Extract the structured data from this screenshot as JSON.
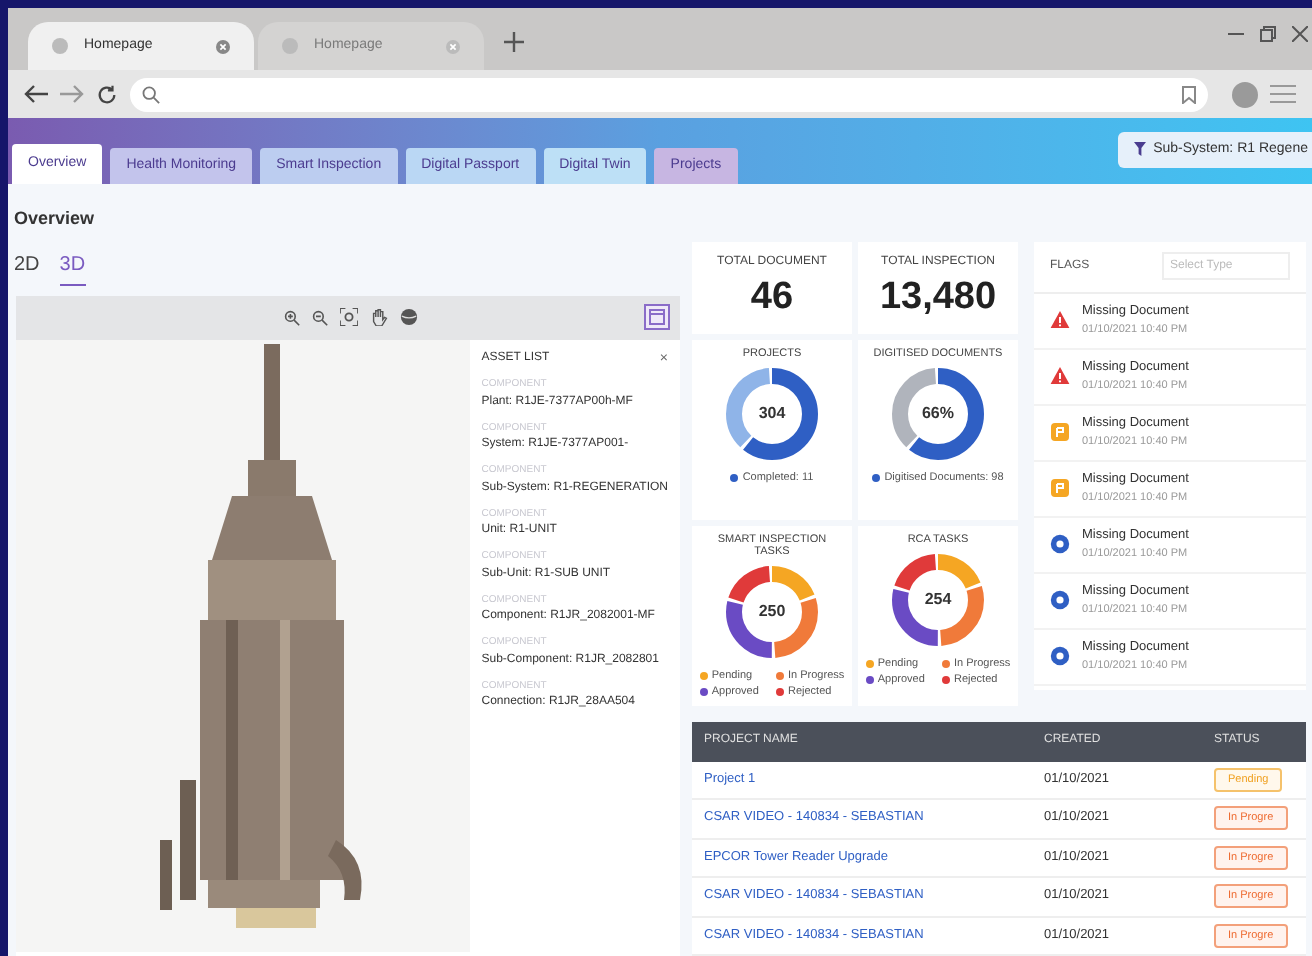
{
  "browser": {
    "tabs": [
      {
        "title": "Homepage",
        "selected": true
      },
      {
        "title": "Homepage",
        "selected": false
      }
    ]
  },
  "app_tabs": [
    {
      "label": "Overview",
      "selected": true
    },
    {
      "label": "Health Monitoring",
      "selected": false
    },
    {
      "label": "Smart Inspection",
      "selected": false
    },
    {
      "label": "Digital Passport",
      "selected": false
    },
    {
      "label": "Digital Twin",
      "selected": false
    },
    {
      "label": "Projects",
      "selected": false
    }
  ],
  "filter": "Sub-System: R1 Regene",
  "page_title": "Overview",
  "view_modes": [
    {
      "label": "2D",
      "selected": false
    },
    {
      "label": "3D",
      "selected": true
    }
  ],
  "asset_list": {
    "title": "ASSET LIST",
    "close": "×",
    "items": [
      {
        "label": "COMPONENT",
        "value": "Plant: R1JE-7377AP00h-MF"
      },
      {
        "label": "COMPONENT",
        "value": "System: R1JE-7377AP001-"
      },
      {
        "label": "COMPONENT",
        "value": "Sub-System: R1-REGENERATION"
      },
      {
        "label": "COMPONENT",
        "value": "Unit: R1-UNIT"
      },
      {
        "label": "COMPONENT",
        "value": "Sub-Unit: R1-SUB UNIT"
      },
      {
        "label": "COMPONENT",
        "value": "Component: R1JR_2082001-MF"
      },
      {
        "label": "COMPONENT",
        "value": "Sub-Component: R1JR_2082801"
      },
      {
        "label": "COMPONENT",
        "value": "Connection: R1JR_28AA504"
      }
    ]
  },
  "stats": [
    {
      "title": "TOTAL DOCUMENT",
      "value": "46"
    },
    {
      "title": "TOTAL INSPECTION",
      "value": "13,480"
    }
  ],
  "donuts": [
    {
      "title": "PROJECTS",
      "center": "304",
      "legend": [
        {
          "label": "Completed: 11",
          "color": "#2f5fc4"
        }
      ]
    },
    {
      "title": "DIGITISED DOCUMENTS",
      "center": "66%",
      "legend": [
        {
          "label": "Digitised Documents: 98",
          "color": "#2f5fc4"
        }
      ]
    },
    {
      "title": "SMART INSPECTION TASKS",
      "center": "250",
      "legend": [
        {
          "label": "Pending",
          "color": "#f5a623"
        },
        {
          "label": "In Progress",
          "color": "#f07a3a"
        },
        {
          "label": "Approved",
          "color": "#6a4bc4"
        },
        {
          "label": "Rejected",
          "color": "#e03a3a"
        }
      ]
    },
    {
      "title": "RCA TASKS",
      "center": "254",
      "legend": [
        {
          "label": "Pending",
          "color": "#f5a623"
        },
        {
          "label": "In Progress",
          "color": "#f07a3a"
        },
        {
          "label": "Approved",
          "color": "#6a4bc4"
        },
        {
          "label": "Rejected",
          "color": "#e03a3a"
        }
      ]
    }
  ],
  "flags": {
    "title": "FLAGS",
    "placeholder": "Select Type",
    "items": [
      {
        "kind": "error",
        "title": "Missing Document",
        "time": "01/10/2021 10:40 PM"
      },
      {
        "kind": "error",
        "title": "Missing Document",
        "time": "01/10/2021 10:40 PM"
      },
      {
        "kind": "warning",
        "title": "Missing Document",
        "time": "01/10/2021 10:40 PM"
      },
      {
        "kind": "warning",
        "title": "Missing Document",
        "time": "01/10/2021 10:40 PM"
      },
      {
        "kind": "info",
        "title": "Missing Document",
        "time": "01/10/2021 10:40 PM"
      },
      {
        "kind": "info",
        "title": "Missing Document",
        "time": "01/10/2021 10:40 PM"
      },
      {
        "kind": "info",
        "title": "Missing Document",
        "time": "01/10/2021 10:40 PM"
      }
    ]
  },
  "table": {
    "columns": [
      "PROJECT NAME",
      "CREATED",
      "STATUS"
    ],
    "rows": [
      {
        "name": "Project 1",
        "created": "01/10/2021",
        "status": "Pending",
        "kind": "pending"
      },
      {
        "name": "CSAR VIDEO - 140834 - SEBASTIAN",
        "created": "01/10/2021",
        "status": "In Progre",
        "kind": "progress"
      },
      {
        "name": "EPCOR Tower Reader Upgrade",
        "created": "01/10/2021",
        "status": "In Progre",
        "kind": "progress"
      },
      {
        "name": "CSAR VIDEO - 140834 - SEBASTIAN",
        "created": "01/10/2021",
        "status": "In Progre",
        "kind": "progress"
      },
      {
        "name": "CSAR VIDEO - 140834 - SEBASTIAN",
        "created": "01/10/2021",
        "status": "In Progre",
        "kind": "progress"
      }
    ]
  }
}
